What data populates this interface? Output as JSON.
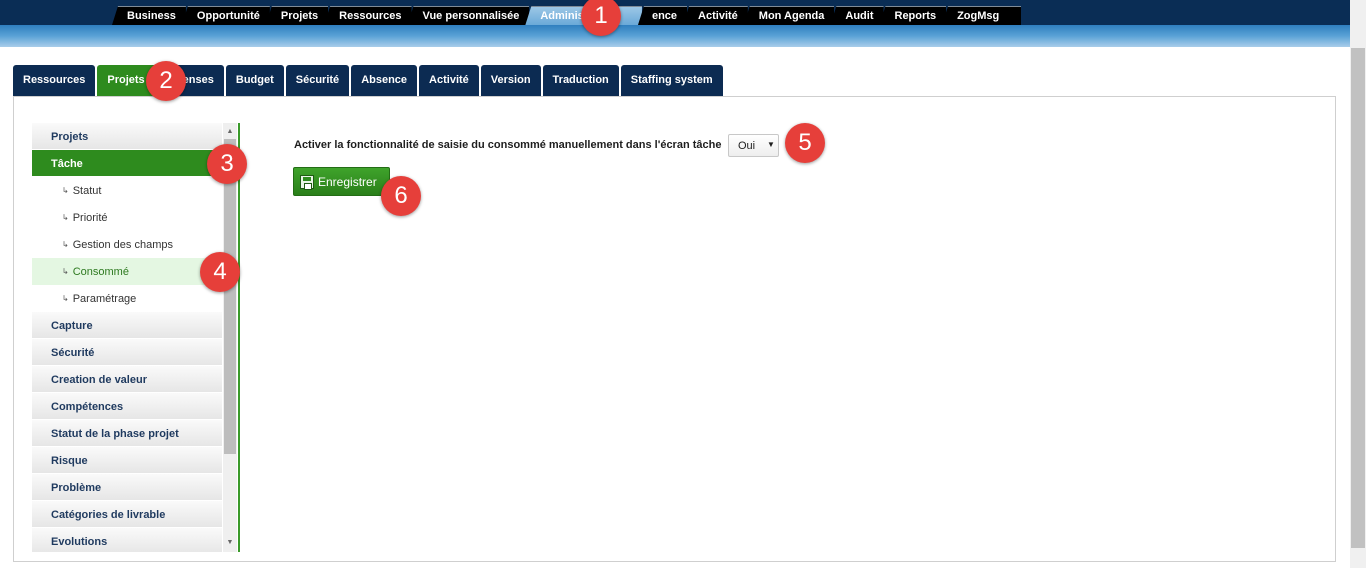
{
  "top_nav": {
    "tabs": [
      "Business",
      "Opportunité",
      "Projets",
      "Ressources",
      "Vue personnalisée",
      "Administration",
      "ence",
      "Activité",
      "Mon Agenda",
      "Audit",
      "Reports",
      "ZogMsg"
    ],
    "active": "Administration"
  },
  "sub_nav": {
    "tabs": [
      "Ressources",
      "Projets",
      "enses",
      "Budget",
      "Sécurité",
      "Absence",
      "Activité",
      "Version",
      "Traduction",
      "Staffing system"
    ],
    "active": "Projets"
  },
  "sidebar": {
    "items": [
      {
        "label": "Projets",
        "type": "section"
      },
      {
        "label": "Tâche",
        "type": "section",
        "active": true
      },
      {
        "label": "Statut",
        "type": "sub"
      },
      {
        "label": "Priorité",
        "type": "sub"
      },
      {
        "label": "Gestion des champs",
        "type": "sub"
      },
      {
        "label": "Consommé",
        "type": "sub",
        "selected": true
      },
      {
        "label": "Paramétrage",
        "type": "sub"
      },
      {
        "label": "Capture",
        "type": "section"
      },
      {
        "label": "Sécurité",
        "type": "section"
      },
      {
        "label": "Creation de valeur",
        "type": "section"
      },
      {
        "label": "Compétences",
        "type": "section"
      },
      {
        "label": "Statut de la phase projet",
        "type": "section"
      },
      {
        "label": "Risque",
        "type": "section"
      },
      {
        "label": "Problème",
        "type": "section"
      },
      {
        "label": "Catégories de livrable",
        "type": "section"
      },
      {
        "label": "Evolutions",
        "type": "section"
      }
    ],
    "sub_arrow": "↳"
  },
  "main": {
    "setting_label": "Activer la fonctionnalité de saisie du consommé manuellement dans l'écran tâche",
    "select_value": "Oui",
    "save_label": "Enregistrer"
  },
  "markers": [
    "1",
    "2",
    "3",
    "4",
    "5",
    "6"
  ],
  "colors": {
    "nav_dark": "#0a2d55",
    "active_green": "#2e8b1e",
    "marker_red": "#e63f3a",
    "selected_bg": "#e4f7e2"
  }
}
